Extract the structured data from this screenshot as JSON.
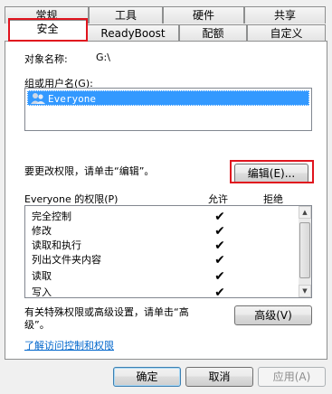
{
  "tabs_row1": [
    {
      "label": "常规",
      "id": "general"
    },
    {
      "label": "工具",
      "id": "tools"
    },
    {
      "label": "硬件",
      "id": "hardware"
    },
    {
      "label": "共享",
      "id": "sharing"
    }
  ],
  "tabs_row2": [
    {
      "label": "安全",
      "id": "security"
    },
    {
      "label": "ReadyBoost",
      "id": "readyboost"
    },
    {
      "label": "配额",
      "id": "quota"
    },
    {
      "label": "自定义",
      "id": "customize"
    }
  ],
  "object": {
    "label": "对象名称:",
    "value": "G:\\"
  },
  "users": {
    "label": "组或用户名(G):",
    "items": [
      "Everyone"
    ]
  },
  "change_text": "要更改权限，请单击“编辑”。",
  "edit_button": "编辑(E)...",
  "perms": {
    "header_label": "Everyone 的权限(P)",
    "allow_header": "允许",
    "deny_header": "拒绝",
    "items": [
      {
        "name": "完全控制",
        "allow": "✔"
      },
      {
        "name": "修改",
        "allow": "✔"
      },
      {
        "name": "读取和执行",
        "allow": "✔"
      },
      {
        "name": "列出文件夹内容",
        "allow": "✔"
      },
      {
        "name": "读取",
        "allow": "✔"
      },
      {
        "name": "写入",
        "allow": "✔"
      }
    ]
  },
  "special_text_line1": "有关特殊权限或高级设置，请单击“高",
  "special_text_line2": "级”。",
  "advanced_button": "高级(V)",
  "learn_link": "了解访问控制和权限",
  "footer": {
    "ok": "确定",
    "cancel": "取消",
    "apply": "应用(A)"
  },
  "colors": {
    "selection": "#3399ff",
    "highlight_border": "#e0141e",
    "link": "#0066cc"
  }
}
